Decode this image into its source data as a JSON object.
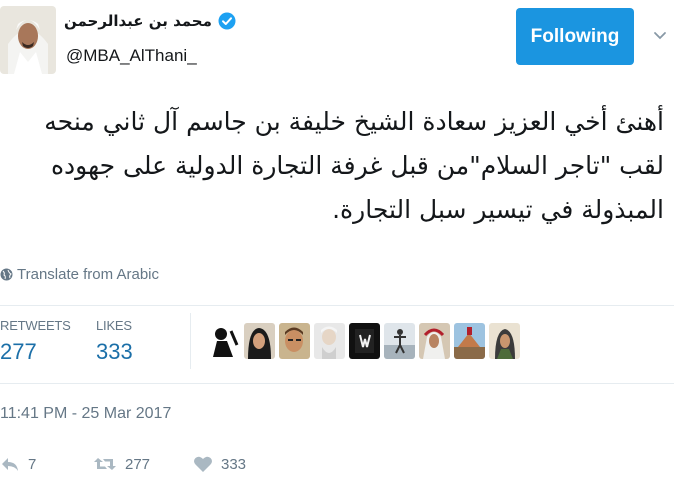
{
  "author": {
    "display_name": "محمد بن عبدالرحمن",
    "handle": "@MBA_AlThani_",
    "verified": true
  },
  "follow_button": {
    "label": "Following"
  },
  "tweet": {
    "text": "أهنئ أخي العزيز سعادة الشيخ خليفة بن جاسم آل ثاني منحه لقب \"تاجر السلام\"من قبل غرفة التجارة الدولية على جهوده المبذولة في تيسير سبل التجارة.",
    "translate_label": "Translate from Arabic",
    "timestamp": "11:41 PM - 25 Mar 2017"
  },
  "stats": {
    "retweets_label": "RETWEETS",
    "retweets_value": "277",
    "likes_label": "LIKES",
    "likes_value": "333"
  },
  "likers_count": 9,
  "actions": {
    "reply_count": "7",
    "retweet_count": "277",
    "like_count": "333"
  },
  "colors": {
    "accent": "#1b95e0",
    "stat_value": "#1b6fa8",
    "muted": "#657786"
  }
}
